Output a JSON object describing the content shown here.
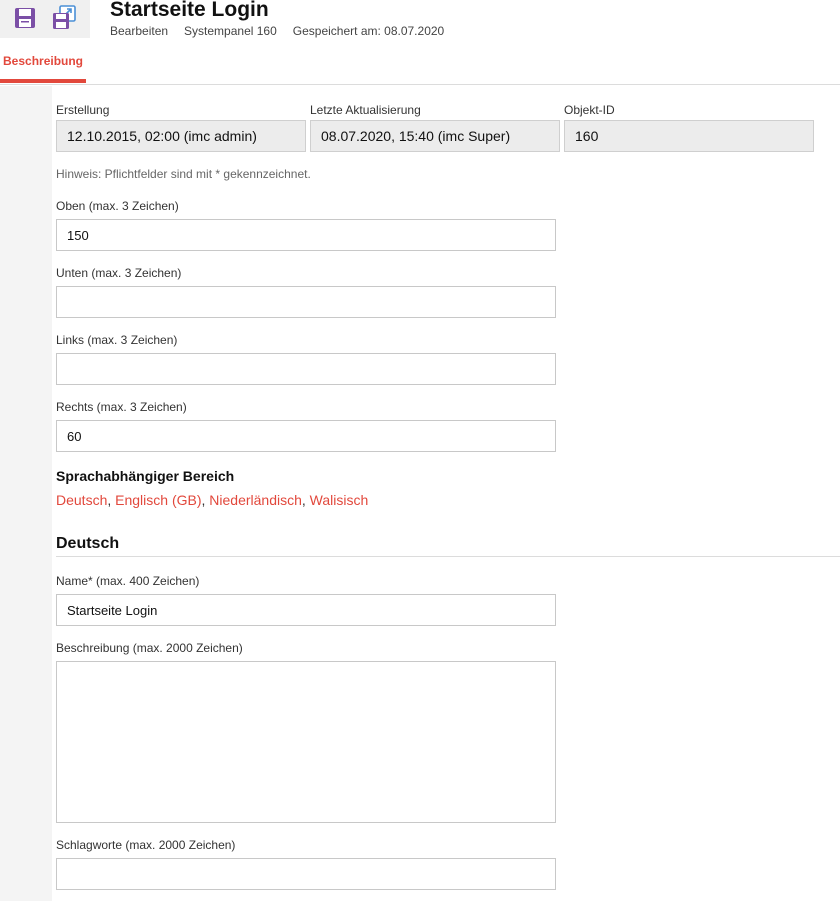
{
  "header": {
    "title": "Startseite Login",
    "meta": [
      "Bearbeiten",
      "Systempanel 160",
      "Gespeichert am: 08.07.2020"
    ]
  },
  "toolbar": {
    "save_icon": "save-icon",
    "save_as_icon": "save-copy-icon"
  },
  "tabs": [
    {
      "label": "Beschreibung",
      "active": true
    }
  ],
  "info": {
    "created_label": "Erstellung",
    "created_value": "12.10.2015, 02:00 (imc admin)",
    "updated_label": "Letzte Aktualisierung",
    "updated_value": "08.07.2020, 15:40 (imc Super)",
    "id_label": "Objekt-ID",
    "id_value": "160"
  },
  "hint": "Hinweis: Pflichtfelder sind mit * gekennzeichnet.",
  "fields": {
    "oben_label": "Oben (max. 3 Zeichen)",
    "oben_value": "150",
    "unten_label": "Unten (max. 3 Zeichen)",
    "unten_value": "",
    "links_label": "Links (max. 3 Zeichen)",
    "links_value": "",
    "rechts_label": "Rechts (max. 3 Zeichen)",
    "rechts_value": "60"
  },
  "lang_section": {
    "title": "Sprachabhängiger Bereich",
    "languages": [
      "Deutsch",
      "Englisch (GB)",
      "Niederländisch",
      "Walisisch"
    ]
  },
  "deutsch": {
    "heading": "Deutsch",
    "name_label": "Name* (max. 400 Zeichen)",
    "name_value": "Startseite Login",
    "desc_label": "Beschreibung (max. 2000 Zeichen)",
    "desc_value": "",
    "keywords_label": "Schlagworte (max. 2000 Zeichen)",
    "keywords_value": ""
  },
  "colors": {
    "accent": "#e2483c",
    "icon_purple": "#7b4fa6"
  }
}
